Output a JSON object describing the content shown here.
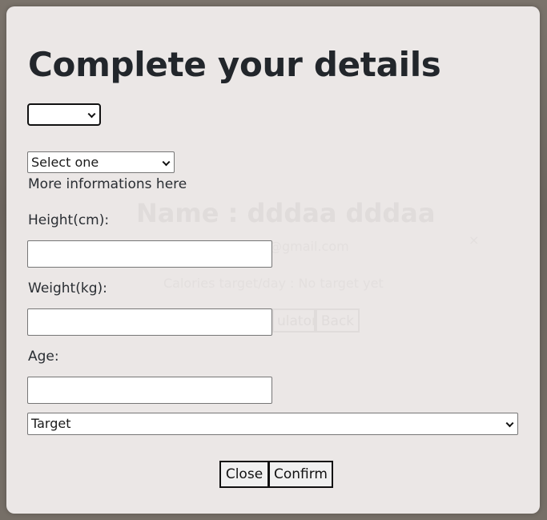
{
  "background": {
    "profile_name": "Name : dddaa dddaa",
    "email": "@gmail.com",
    "calories": "Calories target/day : No target yet",
    "calculator_button": "ulator",
    "back_button": "Back"
  },
  "modal": {
    "title": "Complete your details",
    "first_select_value": "",
    "second_select_value": "Select one",
    "more_info": "More informations here",
    "height_label": "Height(cm):",
    "height_value": "",
    "weight_label": "Weight(kg):",
    "weight_value": "",
    "age_label": "Age:",
    "age_value": "",
    "target_select_value": "Target",
    "close_button": "Close",
    "confirm_button": "Confirm"
  },
  "icons": {
    "dropdown": "chevron-down-icon"
  },
  "colors": {
    "modal_background": "#ebe7e6",
    "title_text": "#22262b"
  }
}
